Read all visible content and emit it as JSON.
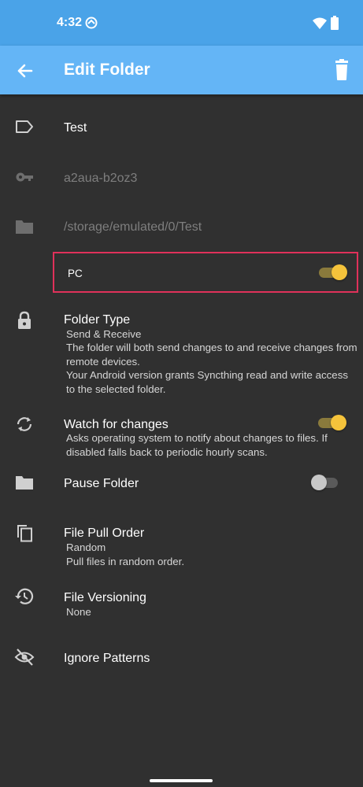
{
  "status_bar": {
    "time": "4:32"
  },
  "app_bar": {
    "title": "Edit Folder"
  },
  "label": {
    "value": "Test"
  },
  "folder_id": {
    "value": "a2aua-b2oz3"
  },
  "folder_path": {
    "value": "/storage/emulated/0/Test"
  },
  "device": {
    "name": "PC",
    "shared": true
  },
  "folder_type": {
    "title": "Folder Type",
    "value": "Send & Receive",
    "description": "The folder will both send changes to and receive changes from remote devices.",
    "note": "Your Android version grants Syncthing read and write access to the selected folder."
  },
  "watch_changes": {
    "title": "Watch for changes",
    "description": "Asks operating system to notify about changes to files. If disabled falls back to periodic hourly scans.",
    "enabled": true
  },
  "pause_folder": {
    "title": "Pause Folder",
    "enabled": false
  },
  "pull_order": {
    "title": "File Pull Order",
    "value": "Random",
    "description": "Pull files in random order."
  },
  "versioning": {
    "title": "File Versioning",
    "value": "None"
  },
  "ignore_patterns": {
    "title": "Ignore Patterns"
  },
  "colors": {
    "status_bar": "#4aa3e8",
    "app_bar": "#64b5f6",
    "background": "#303030",
    "switch_on": "#f5c33b",
    "highlight": "#e0315a"
  }
}
